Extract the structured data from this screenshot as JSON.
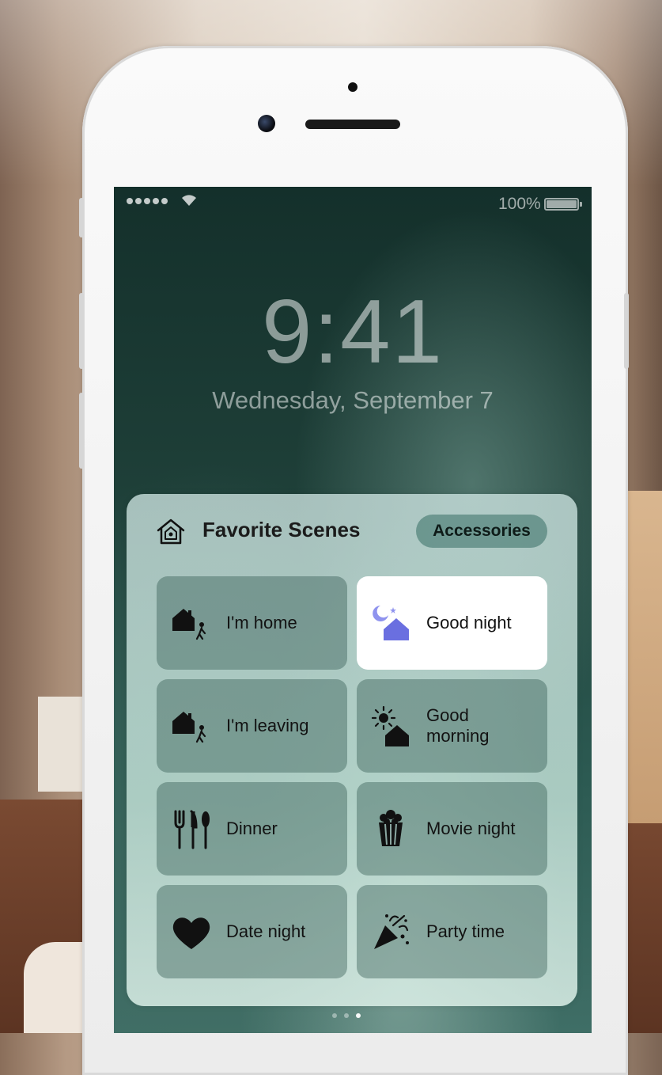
{
  "status_bar": {
    "battery_percent": "100%",
    "signal_bars": 5
  },
  "lock_screen": {
    "time": "9:41",
    "date": "Wednesday, September 7"
  },
  "widget": {
    "title": "Favorite Scenes",
    "accessories_button": "Accessories",
    "scenes": [
      {
        "label": "I'm home",
        "icon": "house-person-icon",
        "active": false
      },
      {
        "label": "Good night",
        "icon": "moon-house-icon",
        "active": true
      },
      {
        "label": "I'm leaving",
        "icon": "house-person-leaving-icon",
        "active": false
      },
      {
        "label": "Good\nmorning",
        "icon": "sun-house-icon",
        "active": false
      },
      {
        "label": "Dinner",
        "icon": "fork-knife-icon",
        "active": false
      },
      {
        "label": "Movie night",
        "icon": "popcorn-icon",
        "active": false
      },
      {
        "label": "Date night",
        "icon": "heart-icon",
        "active": false
      },
      {
        "label": "Party time",
        "icon": "party-popper-icon",
        "active": false
      }
    ]
  },
  "page_indicator": {
    "count": 3,
    "current": 3
  },
  "colors": {
    "active_tile": "#ffffff",
    "good_night_icon": "#6a6fe0"
  }
}
